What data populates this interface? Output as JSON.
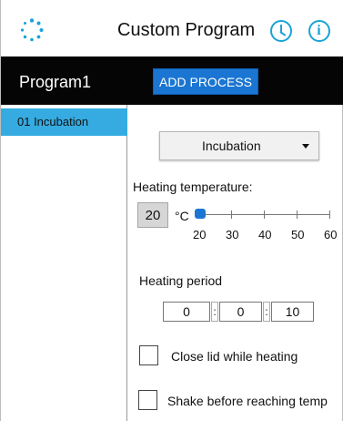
{
  "header": {
    "title": "Custom Program",
    "logo_icon": "loading-dots-icon",
    "clock_icon": "clock-icon",
    "info_icon": "info-icon"
  },
  "bar": {
    "program_name": "Program1",
    "add_process_label": "ADD PROCESS"
  },
  "left_panel": {
    "items": [
      {
        "label": "01  Incubation",
        "selected": true
      }
    ]
  },
  "process": {
    "selected": "Incubation",
    "heating_temperature_label": "Heating temperature:",
    "temperature_value": "20",
    "unit": "°C",
    "slider": {
      "min": 20,
      "max": 60,
      "value": 20,
      "ticks": [
        "20",
        "30",
        "40",
        "50",
        "60"
      ]
    },
    "heating_period_label": "Heating period",
    "period": {
      "hours": "0",
      "minutes": "0",
      "seconds": "10",
      "separator": ":"
    },
    "close_lid_label": "Close lid while heating",
    "close_lid_checked": false,
    "shake_label": "Shake before reaching temp",
    "shake_checked": false
  },
  "colors": {
    "accent": "#19a3d6",
    "button": "#1b75d2",
    "selected_row": "#35abe1",
    "bar": "#050505"
  }
}
